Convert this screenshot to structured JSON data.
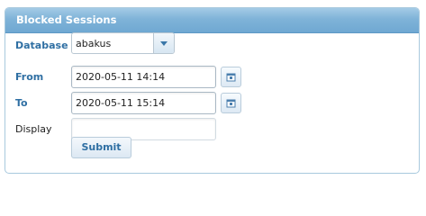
{
  "panel": {
    "title": "Blocked Sessions"
  },
  "form": {
    "database": {
      "label": "Database",
      "value": "abakus"
    },
    "from": {
      "label": "From",
      "value": "2020-05-11 14:14"
    },
    "to": {
      "label": "To",
      "value": "2020-05-11 15:14"
    },
    "display": {
      "label": "Display",
      "value": ""
    },
    "submit_label": "Submit"
  },
  "icons": {
    "calendar": "calendar-icon",
    "dropdown": "chevron-down-icon"
  },
  "colors": {
    "header": "#7fb3d8",
    "label_accent": "#2f6fa3",
    "border": "#a8c9de"
  }
}
